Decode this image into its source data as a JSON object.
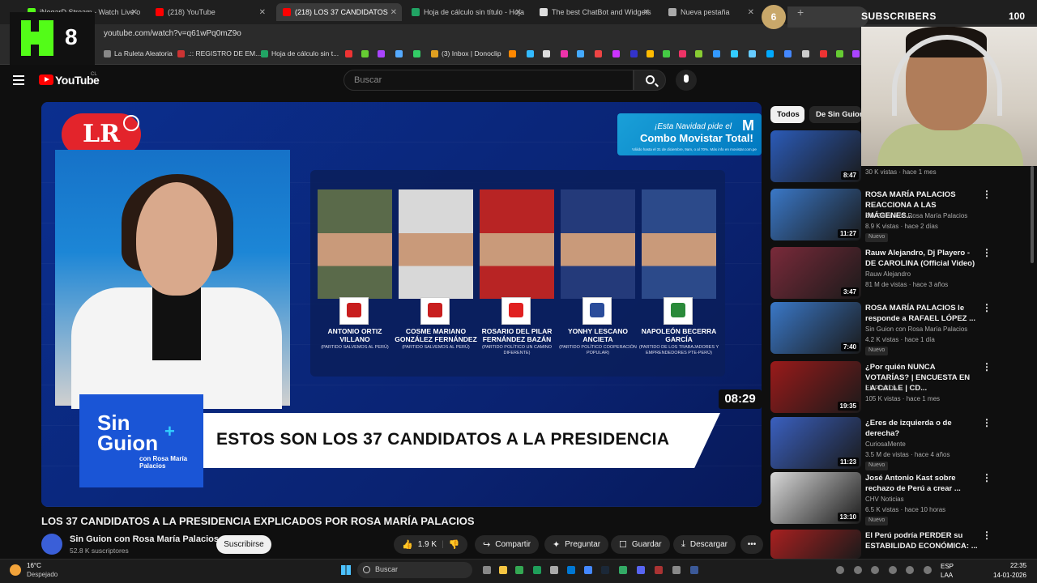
{
  "browser": {
    "tabs": [
      {
        "label": "iNoqarD Stream - Watch Live o",
        "color": "#53fc18"
      },
      {
        "label": "(218) YouTube",
        "color": "#ff0000"
      },
      {
        "label": "(218) LOS 37 CANDIDATOS",
        "color": "#ff0000"
      },
      {
        "label": "Hoja de cálculo sin título - Hoja",
        "color": "#21a464"
      },
      {
        "label": "The best ChatBot and Widgets",
        "color": "#dddddd"
      },
      {
        "label": "Nueva pestaña",
        "color": "#aaaaaa"
      }
    ],
    "url": "youtube.com/watch?v=q61wPq0mZ9o",
    "bookmarks": [
      {
        "label": "La Ruleta Aleatoria"
      },
      {
        "label": ".:: REGISTRO DE EM..."
      },
      {
        "label": "Hoja de cálculo sin t..."
      },
      {
        "label": "(3) Inbox | Donoclip"
      }
    ]
  },
  "kick_overlay": {
    "number": "8"
  },
  "subscribers_overlay": {
    "badge": "6",
    "label": "SUBSCRIBERS",
    "count": "100"
  },
  "youtube": {
    "logo_text": "YouTube",
    "country": "CL",
    "search_placeholder": "Buscar",
    "player": {
      "duration": "08:29",
      "lr_logo": "LR",
      "ad": {
        "line1": "¡Esta Navidad pide el",
        "line2": "Combo Movistar Total!",
        "fine": "Válido hasta el 31 de diciembre, 9am, o al 70%. Más info en movistar.com.pe"
      },
      "show_title": "Sin Guion",
      "show_sub": "con Rosa María Palacios",
      "banner": "ESTOS SON LOS 37 CANDIDATOS A LA PRESIDENCIA",
      "candidates": [
        {
          "name": "ANTONIO ORTIZ VILLANO",
          "party": "(PARTIDO SALVEMOS AL PERÚ)",
          "color": "#c81e1e",
          "bg": "#5a6a4a"
        },
        {
          "name": "COSME MARIANO GONZÁLEZ FERNÁNDEZ",
          "party": "(PARTIDO SALVEMOS AL PERÚ)",
          "color": "#c81e1e",
          "bg": "#d8d8d8"
        },
        {
          "name": "ROSARIO DEL PILAR FERNÁNDEZ BAZÁN",
          "party": "(PARTIDO POLÍTICO UN CAMINO DIFERENTE)",
          "color": "#e02020",
          "bg": "#b82424"
        },
        {
          "name": "YONHY LESCANO ANCIETA",
          "party": "(PARTIDO POLÍTICO COOPERACIÓN POPULAR)",
          "color": "#2a4c9a",
          "bg": "#243a7a"
        },
        {
          "name": "NAPOLEÓN BECERRA GARCÍA",
          "party": "(PARTIDO DE LOS TRABAJADORES Y EMPRENDEDORES PTE-PERÚ)",
          "color": "#2a8a3a",
          "bg": "#2c4a8a"
        }
      ]
    },
    "video": {
      "title": "LOS 37 CANDIDATOS A LA PRESIDENCIA EXPLICADOS POR ROSA MARÍA PALACIOS",
      "channel": "Sin Guion con Rosa María Palacios",
      "subscribers": "52.8 K suscriptores",
      "subscribe_label": "Suscribirse",
      "likes": "1.9 K",
      "share": "Compartir",
      "ask": "Preguntar",
      "save": "Guardar",
      "download": "Descargar"
    },
    "chips": [
      "Todos",
      "De Sin Guion c"
    ],
    "recommendations": [
      {
        "title": "",
        "channel": "",
        "meta": "30 K vistas · hace 1 mes",
        "duration": "8:47",
        "badge": "",
        "thumb": "#2b5bb8"
      },
      {
        "title": "ROSA MARÍA PALACIOS REACCIONA A LAS IMÁGENES...",
        "channel": "Sin Guion con Rosa María Palacios",
        "meta": "8.9 K vistas · hace 2 días",
        "duration": "11:27",
        "badge": "Nuevo",
        "thumb": "#3a78c8"
      },
      {
        "title": "Rauw Alejandro, Dj Playero - DE CAROLINA (Official Video)",
        "channel": "Rauw Alejandro",
        "meta": "81 M de vistas · hace 3 años",
        "duration": "3:47",
        "badge": "",
        "thumb": "#7a2a3a"
      },
      {
        "title": "ROSA MARÍA PALACIOS le responde a RAFAEL LÓPEZ ...",
        "channel": "Sin Guion con Rosa María Palacios",
        "meta": "4.2 K vistas · hace 1 día",
        "duration": "7:40",
        "badge": "Nuevo",
        "thumb": "#3a78c8"
      },
      {
        "title": "¿Por quién NUNCA VOTARÍAS? | ENCUESTA EN LA CALLE | CD...",
        "channel": "EL FOCO+",
        "meta": "105 K vistas · hace 1 mes",
        "duration": "19:35",
        "badge": "",
        "thumb": "#9a1a1a"
      },
      {
        "title": "¿Eres de izquierda o de derecha?",
        "channel": "CuriosaMente",
        "meta": "3.5 M de vistas · hace 4 años",
        "duration": "11:23",
        "badge": "Nuevo",
        "thumb": "#3a60c0"
      },
      {
        "title": "José Antonio Kast sobre rechazo de Perú a crear ...",
        "channel": "CHV Noticias",
        "meta": "6.5 K vistas · hace 10 horas",
        "duration": "13:10",
        "badge": "Nuevo",
        "thumb": "#d8d8d8"
      },
      {
        "title": "El Perú podría PERDER su ESTABILIDAD ECONÓMICA: ...",
        "channel": "",
        "meta": "",
        "duration": "",
        "badge": "",
        "thumb": "#a82020"
      }
    ]
  },
  "taskbar": {
    "temp": "16°C",
    "weather": "Despejado",
    "search": "Buscar",
    "lang1": "ESP",
    "lang2": "LAA",
    "time": "22:35",
    "date": "14-01-2026"
  }
}
